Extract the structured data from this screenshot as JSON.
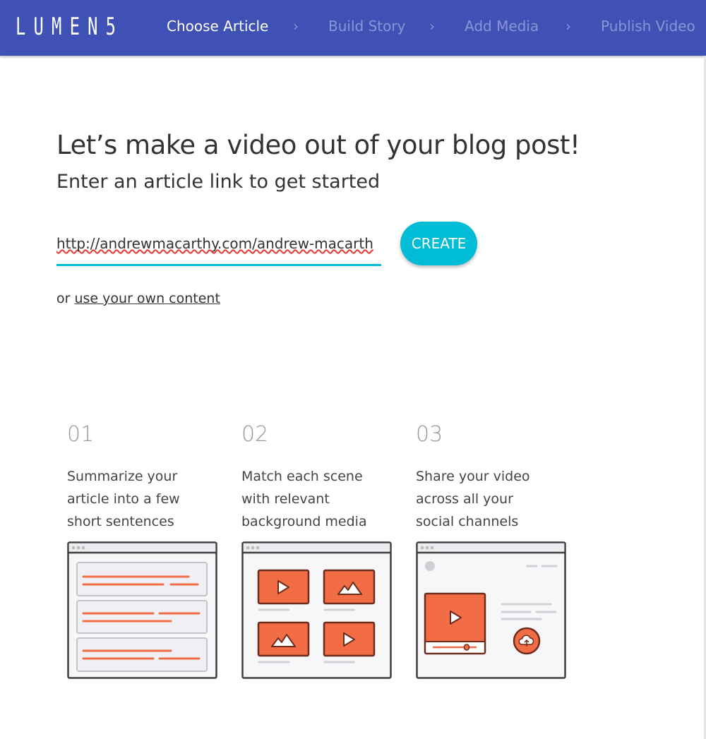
{
  "brand": {
    "logo": "LUMEN5",
    "nav_color": "#3f51b5",
    "accent": "#00bcd4",
    "illustration_color": "#f26c45"
  },
  "nav": {
    "steps": [
      {
        "label": "Choose Article",
        "active": true
      },
      {
        "label": "Build Story",
        "active": false
      },
      {
        "label": "Add Media",
        "active": false
      },
      {
        "label": "Publish Video",
        "active": false
      }
    ],
    "separator": "›"
  },
  "main": {
    "title": "Let’s make a video out of your blog post!",
    "subtitle": "Enter an article link to get started",
    "url_input": {
      "value": "http://andrewmacarthy.com/andrew-macarth"
    },
    "create_label": "CREATE",
    "alt_prefix": "or",
    "alt_link": "use your own content"
  },
  "steps": [
    {
      "number": "01",
      "text": "Summarize your article into a few short sentences",
      "icon": "text-summary-illustration"
    },
    {
      "number": "02",
      "text": "Match each scene with relevant background media",
      "icon": "media-grid-illustration"
    },
    {
      "number": "03",
      "text": "Share your video across all your social channels",
      "icon": "share-video-illustration"
    }
  ]
}
